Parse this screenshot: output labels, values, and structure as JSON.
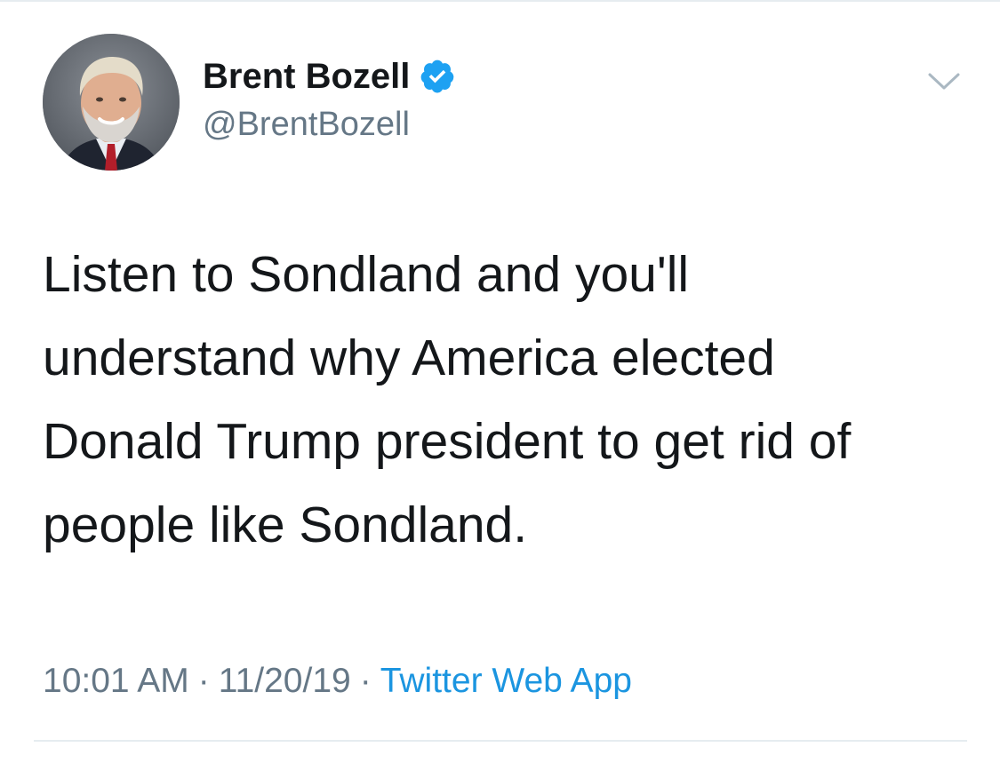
{
  "tweet": {
    "author": {
      "display_name": "Brent Bozell",
      "handle": "@BrentBozell",
      "verified": true,
      "avatar_icon": "profile-photo"
    },
    "text_lines": [
      "Listen to Sondland and you'll",
      "understand why America elected",
      "Donald Trump president to get rid of",
      "people like Sondland."
    ],
    "meta": {
      "time": "10:01 AM",
      "separator": "·",
      "date": "11/20/19",
      "source": "Twitter Web App"
    },
    "menu_icon": "chevron-down-icon"
  },
  "colors": {
    "text_primary": "#14171a",
    "text_secondary": "#657786",
    "accent": "#1b95e0",
    "verified_badge": "#1da1f2",
    "divider": "#e6ecf0"
  }
}
